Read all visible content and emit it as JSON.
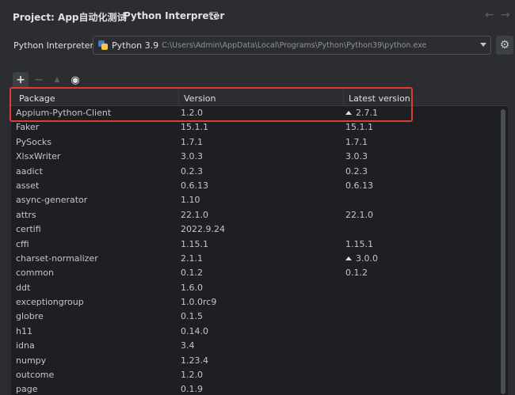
{
  "header": {
    "project_label": "Project: App自动化测试",
    "separator": "›",
    "current_label": "Python Interpreter",
    "back_arrow": "←",
    "forward_arrow": "→"
  },
  "interpreter": {
    "label": "Python Interpreter:",
    "name": "Python 3.9",
    "path": "C:\\Users\\Admin\\AppData\\Local\\Programs\\Python\\Python39\\python.exe",
    "icon": "python-icon"
  },
  "toolbar": {
    "add": "+",
    "remove": "−",
    "upgrade": "▲",
    "show_early": "👁"
  },
  "table": {
    "columns": [
      "Package",
      "Version",
      "Latest version"
    ],
    "rows": [
      {
        "package": "Appium-Python-Client",
        "version": "1.2.0",
        "latest": "2.7.1",
        "upgrade": true
      },
      {
        "package": "Faker",
        "version": "15.1.1",
        "latest": "15.1.1",
        "upgrade": false
      },
      {
        "package": "PySocks",
        "version": "1.7.1",
        "latest": "1.7.1",
        "upgrade": false
      },
      {
        "package": "XlsxWriter",
        "version": "3.0.3",
        "latest": "3.0.3",
        "upgrade": false
      },
      {
        "package": "aadict",
        "version": "0.2.3",
        "latest": "0.2.3",
        "upgrade": false
      },
      {
        "package": "asset",
        "version": "0.6.13",
        "latest": "0.6.13",
        "upgrade": false
      },
      {
        "package": "async-generator",
        "version": "1.10",
        "latest": "",
        "upgrade": false
      },
      {
        "package": "attrs",
        "version": "22.1.0",
        "latest": "22.1.0",
        "upgrade": false
      },
      {
        "package": "certifi",
        "version": "2022.9.24",
        "latest": "",
        "upgrade": false
      },
      {
        "package": "cffi",
        "version": "1.15.1",
        "latest": "1.15.1",
        "upgrade": false
      },
      {
        "package": "charset-normalizer",
        "version": "2.1.1",
        "latest": "3.0.0",
        "upgrade": true
      },
      {
        "package": "common",
        "version": "0.1.2",
        "latest": "0.1.2",
        "upgrade": false
      },
      {
        "package": "ddt",
        "version": "1.6.0",
        "latest": "",
        "upgrade": false
      },
      {
        "package": "exceptiongroup",
        "version": "1.0.0rc9",
        "latest": "",
        "upgrade": false
      },
      {
        "package": "globre",
        "version": "0.1.5",
        "latest": "",
        "upgrade": false
      },
      {
        "package": "h11",
        "version": "0.14.0",
        "latest": "",
        "upgrade": false
      },
      {
        "package": "idna",
        "version": "3.4",
        "latest": "",
        "upgrade": false
      },
      {
        "package": "numpy",
        "version": "1.23.4",
        "latest": "",
        "upgrade": false
      },
      {
        "package": "outcome",
        "version": "1.2.0",
        "latest": "",
        "upgrade": false
      },
      {
        "package": "page",
        "version": "0.1.9",
        "latest": "",
        "upgrade": false
      }
    ]
  },
  "colors": {
    "background": "#2b2d30",
    "table_background": "#1e1f22",
    "highlight": "#e53935",
    "text": "#dfe1e5"
  }
}
